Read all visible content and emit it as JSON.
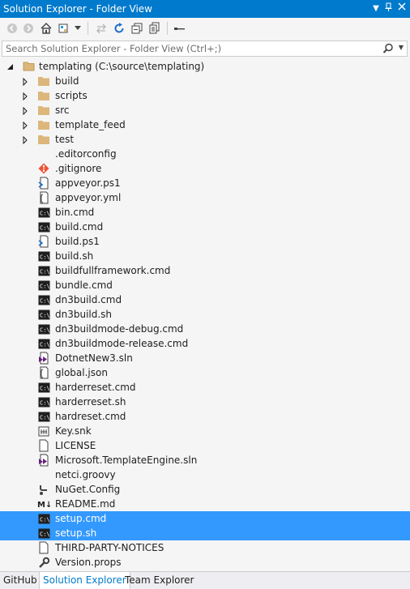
{
  "window": {
    "title": "Solution Explorer - Folder View"
  },
  "toolbar": {
    "buttons": [
      "back-icon",
      "forward-icon",
      "home-icon",
      "switch-views-icon",
      "dropdown-icon",
      "sync-icon",
      "refresh-icon",
      "collapse-all-icon",
      "show-all-files-icon",
      "properties-icon"
    ]
  },
  "search": {
    "placeholder": "Search Solution Explorer - Folder View (Ctrl+;)"
  },
  "tree": {
    "root": "templating (C:\\source\\templating)",
    "items": [
      {
        "label": "build",
        "kind": "folder"
      },
      {
        "label": "scripts",
        "kind": "folder"
      },
      {
        "label": "src",
        "kind": "folder"
      },
      {
        "label": "template_feed",
        "kind": "folder"
      },
      {
        "label": "test",
        "kind": "folder"
      },
      {
        "label": ".editorconfig",
        "kind": "blank"
      },
      {
        "label": ".gitignore",
        "kind": "git"
      },
      {
        "label": "appveyor.ps1",
        "kind": "ps"
      },
      {
        "label": "appveyor.yml",
        "kind": "json"
      },
      {
        "label": "bin.cmd",
        "kind": "cmd"
      },
      {
        "label": "build.cmd",
        "kind": "cmd"
      },
      {
        "label": "build.ps1",
        "kind": "ps"
      },
      {
        "label": "build.sh",
        "kind": "cmd"
      },
      {
        "label": "buildfullframework.cmd",
        "kind": "cmd"
      },
      {
        "label": "bundle.cmd",
        "kind": "cmd"
      },
      {
        "label": "dn3build.cmd",
        "kind": "cmd"
      },
      {
        "label": "dn3build.sh",
        "kind": "cmd"
      },
      {
        "label": "dn3buildmode-debug.cmd",
        "kind": "cmd"
      },
      {
        "label": "dn3buildmode-release.cmd",
        "kind": "cmd"
      },
      {
        "label": "DotnetNew3.sln",
        "kind": "sln"
      },
      {
        "label": "global.json",
        "kind": "json"
      },
      {
        "label": "harderreset.cmd",
        "kind": "cmd"
      },
      {
        "label": "harderreset.sh",
        "kind": "cmd"
      },
      {
        "label": "hardreset.cmd",
        "kind": "cmd"
      },
      {
        "label": "Key.snk",
        "kind": "key"
      },
      {
        "label": "LICENSE",
        "kind": "doc"
      },
      {
        "label": "Microsoft.TemplateEngine.sln",
        "kind": "sln"
      },
      {
        "label": "netci.groovy",
        "kind": "blank"
      },
      {
        "label": "NuGet.Config",
        "kind": "config"
      },
      {
        "label": "README.md",
        "kind": "md"
      },
      {
        "label": "setup.cmd",
        "kind": "cmd",
        "selected": true
      },
      {
        "label": "setup.sh",
        "kind": "cmd",
        "selected": true
      },
      {
        "label": "THIRD-PARTY-NOTICES",
        "kind": "doc"
      },
      {
        "label": "Version.props",
        "kind": "wrench"
      }
    ]
  },
  "tabs": [
    "GitHub",
    "Solution Explorer",
    "Team Explorer"
  ],
  "active_tab": "Solution Explorer",
  "colors": {
    "accent": "#007acc",
    "selection": "#3399ff",
    "folder": "#dcb67a"
  }
}
